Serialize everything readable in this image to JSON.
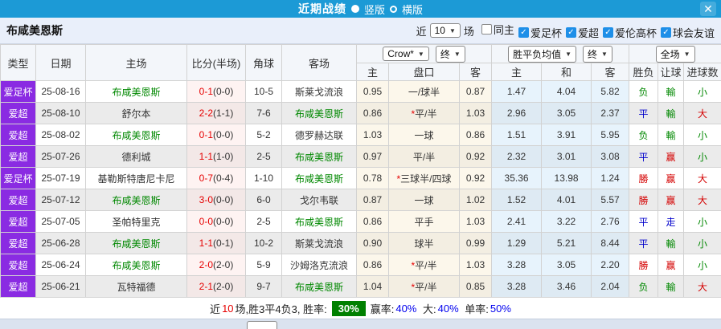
{
  "title_bar": {
    "title": "近期战绩",
    "vertical_label": "竖版",
    "horizontal_label": "横版",
    "selected_layout": "竖版",
    "close_glyph": "✕"
  },
  "filter_bar": {
    "team": "布咸美恩斯",
    "recent_label": "近",
    "recent_count": "10",
    "recent_suffix": "场",
    "checkboxes": [
      {
        "label": "同主",
        "checked": false
      },
      {
        "label": "爱足杯",
        "checked": true
      },
      {
        "label": "爱超",
        "checked": true
      },
      {
        "label": "爱伦高杯",
        "checked": true
      },
      {
        "label": "球会友谊",
        "checked": true
      }
    ]
  },
  "table": {
    "base_headers": [
      "类型",
      "日期",
      "主场",
      "比分(半场)",
      "角球",
      "客场"
    ],
    "selects": {
      "bookmaker": "Crow*",
      "bookmaker_time": "终",
      "europe": "胜平负均值",
      "europe_time": "终",
      "scope": "全场"
    },
    "sub_headers": [
      "主",
      "盘口",
      "客",
      "主",
      "和",
      "客",
      "胜负",
      "让球",
      "进球数"
    ],
    "rows": [
      {
        "type": "爱足杯",
        "date": "25-08-16",
        "home": "布咸美恩斯",
        "home_highlight": true,
        "score": "0-1",
        "half": "(0-0)",
        "corner": "10-5",
        "away": "斯莱戈流浪",
        "away_highlight": false,
        "asian_home": "0.95",
        "handicap": "一/球半",
        "handicap_star": false,
        "asian_away": "0.87",
        "avg_win": "1.47",
        "avg_draw": "4.04",
        "avg_lose": "5.82",
        "outcome": "负",
        "outcome_color": "green",
        "handicap_result": "輸",
        "handicap_result_color": "green",
        "goals": "小",
        "goals_color": "green"
      },
      {
        "type": "爱超",
        "date": "25-08-10",
        "home": "舒尔本",
        "home_highlight": false,
        "score": "2-2",
        "half": "(1-1)",
        "corner": "7-6",
        "away": "布咸美恩斯",
        "away_highlight": true,
        "asian_home": "0.86",
        "handicap": "平/半",
        "handicap_star": true,
        "asian_away": "1.03",
        "avg_win": "2.96",
        "avg_draw": "3.05",
        "avg_lose": "2.37",
        "outcome": "平",
        "outcome_color": "blue",
        "handicap_result": "輸",
        "handicap_result_color": "green",
        "goals": "大",
        "goals_color": "red"
      },
      {
        "type": "爱超",
        "date": "25-08-02",
        "home": "布咸美恩斯",
        "home_highlight": true,
        "score": "0-1",
        "half": "(0-0)",
        "corner": "5-2",
        "away": "德罗赫达联",
        "away_highlight": false,
        "asian_home": "1.03",
        "handicap": "一球",
        "handicap_star": false,
        "asian_away": "0.86",
        "avg_win": "1.51",
        "avg_draw": "3.91",
        "avg_lose": "5.95",
        "outcome": "负",
        "outcome_color": "green",
        "handicap_result": "輸",
        "handicap_result_color": "green",
        "goals": "小",
        "goals_color": "green"
      },
      {
        "type": "爱超",
        "date": "25-07-26",
        "home": "德利城",
        "home_highlight": false,
        "score": "1-1",
        "half": "(1-0)",
        "corner": "2-5",
        "away": "布咸美恩斯",
        "away_highlight": true,
        "asian_home": "0.97",
        "handicap": "平/半",
        "handicap_star": false,
        "asian_away": "0.92",
        "avg_win": "2.32",
        "avg_draw": "3.01",
        "avg_lose": "3.08",
        "outcome": "平",
        "outcome_color": "blue",
        "handicap_result": "赢",
        "handicap_result_color": "red",
        "goals": "小",
        "goals_color": "green"
      },
      {
        "type": "爱足杯",
        "date": "25-07-19",
        "home": "基勒斯特唐尼卡尼",
        "home_highlight": false,
        "score": "0-7",
        "half": "(0-4)",
        "corner": "1-10",
        "away": "布咸美恩斯",
        "away_highlight": true,
        "asian_home": "0.78",
        "handicap": "三球半/四球",
        "handicap_star": true,
        "asian_away": "0.92",
        "avg_win": "35.36",
        "avg_draw": "13.98",
        "avg_lose": "1.24",
        "outcome": "勝",
        "outcome_color": "red",
        "handicap_result": "赢",
        "handicap_result_color": "red",
        "goals": "大",
        "goals_color": "red"
      },
      {
        "type": "爱超",
        "date": "25-07-12",
        "home": "布咸美恩斯",
        "home_highlight": true,
        "score": "3-0",
        "half": "(0-0)",
        "corner": "6-0",
        "away": "戈尔韦联",
        "away_highlight": false,
        "asian_home": "0.87",
        "handicap": "一球",
        "handicap_star": false,
        "asian_away": "1.02",
        "avg_win": "1.52",
        "avg_draw": "4.01",
        "avg_lose": "5.57",
        "outcome": "勝",
        "outcome_color": "red",
        "handicap_result": "赢",
        "handicap_result_color": "red",
        "goals": "大",
        "goals_color": "red"
      },
      {
        "type": "爱超",
        "date": "25-07-05",
        "home": "圣帕特里克",
        "home_highlight": false,
        "score": "0-0",
        "half": "(0-0)",
        "corner": "2-5",
        "away": "布咸美恩斯",
        "away_highlight": true,
        "asian_home": "0.86",
        "handicap": "平手",
        "handicap_star": false,
        "asian_away": "1.03",
        "avg_win": "2.41",
        "avg_draw": "3.22",
        "avg_lose": "2.76",
        "outcome": "平",
        "outcome_color": "blue",
        "handicap_result": "走",
        "handicap_result_color": "blue",
        "goals": "小",
        "goals_color": "green"
      },
      {
        "type": "爱超",
        "date": "25-06-28",
        "home": "布咸美恩斯",
        "home_highlight": true,
        "score": "1-1",
        "half": "(0-1)",
        "corner": "10-2",
        "away": "斯莱戈流浪",
        "away_highlight": false,
        "asian_home": "0.90",
        "handicap": "球半",
        "handicap_star": false,
        "asian_away": "0.99",
        "avg_win": "1.29",
        "avg_draw": "5.21",
        "avg_lose": "8.44",
        "outcome": "平",
        "outcome_color": "blue",
        "handicap_result": "輸",
        "handicap_result_color": "green",
        "goals": "小",
        "goals_color": "green"
      },
      {
        "type": "爱超",
        "date": "25-06-24",
        "home": "布咸美恩斯",
        "home_highlight": true,
        "score": "2-0",
        "half": "(2-0)",
        "corner": "5-9",
        "away": "沙姆洛克流浪",
        "away_highlight": false,
        "asian_home": "0.86",
        "handicap": "平/半",
        "handicap_star": true,
        "asian_away": "1.03",
        "avg_win": "3.28",
        "avg_draw": "3.05",
        "avg_lose": "2.20",
        "outcome": "勝",
        "outcome_color": "red",
        "handicap_result": "赢",
        "handicap_result_color": "red",
        "goals": "小",
        "goals_color": "green"
      },
      {
        "type": "爱超",
        "date": "25-06-21",
        "home": "瓦特福德",
        "home_highlight": false,
        "score": "2-1",
        "half": "(2-0)",
        "corner": "9-7",
        "away": "布咸美恩斯",
        "away_highlight": true,
        "asian_home": "1.04",
        "handicap": "平/半",
        "handicap_star": true,
        "asian_away": "0.85",
        "avg_win": "3.28",
        "avg_draw": "3.46",
        "avg_lose": "2.04",
        "outcome": "负",
        "outcome_color": "green",
        "handicap_result": "輸",
        "handicap_result_color": "green",
        "goals": "大",
        "goals_color": "red"
      }
    ]
  },
  "footer": {
    "text_before_count": "近",
    "count": "10",
    "text_after_count": "场,胜3平4负3, 胜率:",
    "win_rate": "30%",
    "pairs": [
      {
        "label": "赢率:",
        "value": "40%"
      },
      {
        "label": "大:",
        "value": "40%"
      },
      {
        "label": "单率:",
        "value": "50%"
      }
    ]
  }
}
